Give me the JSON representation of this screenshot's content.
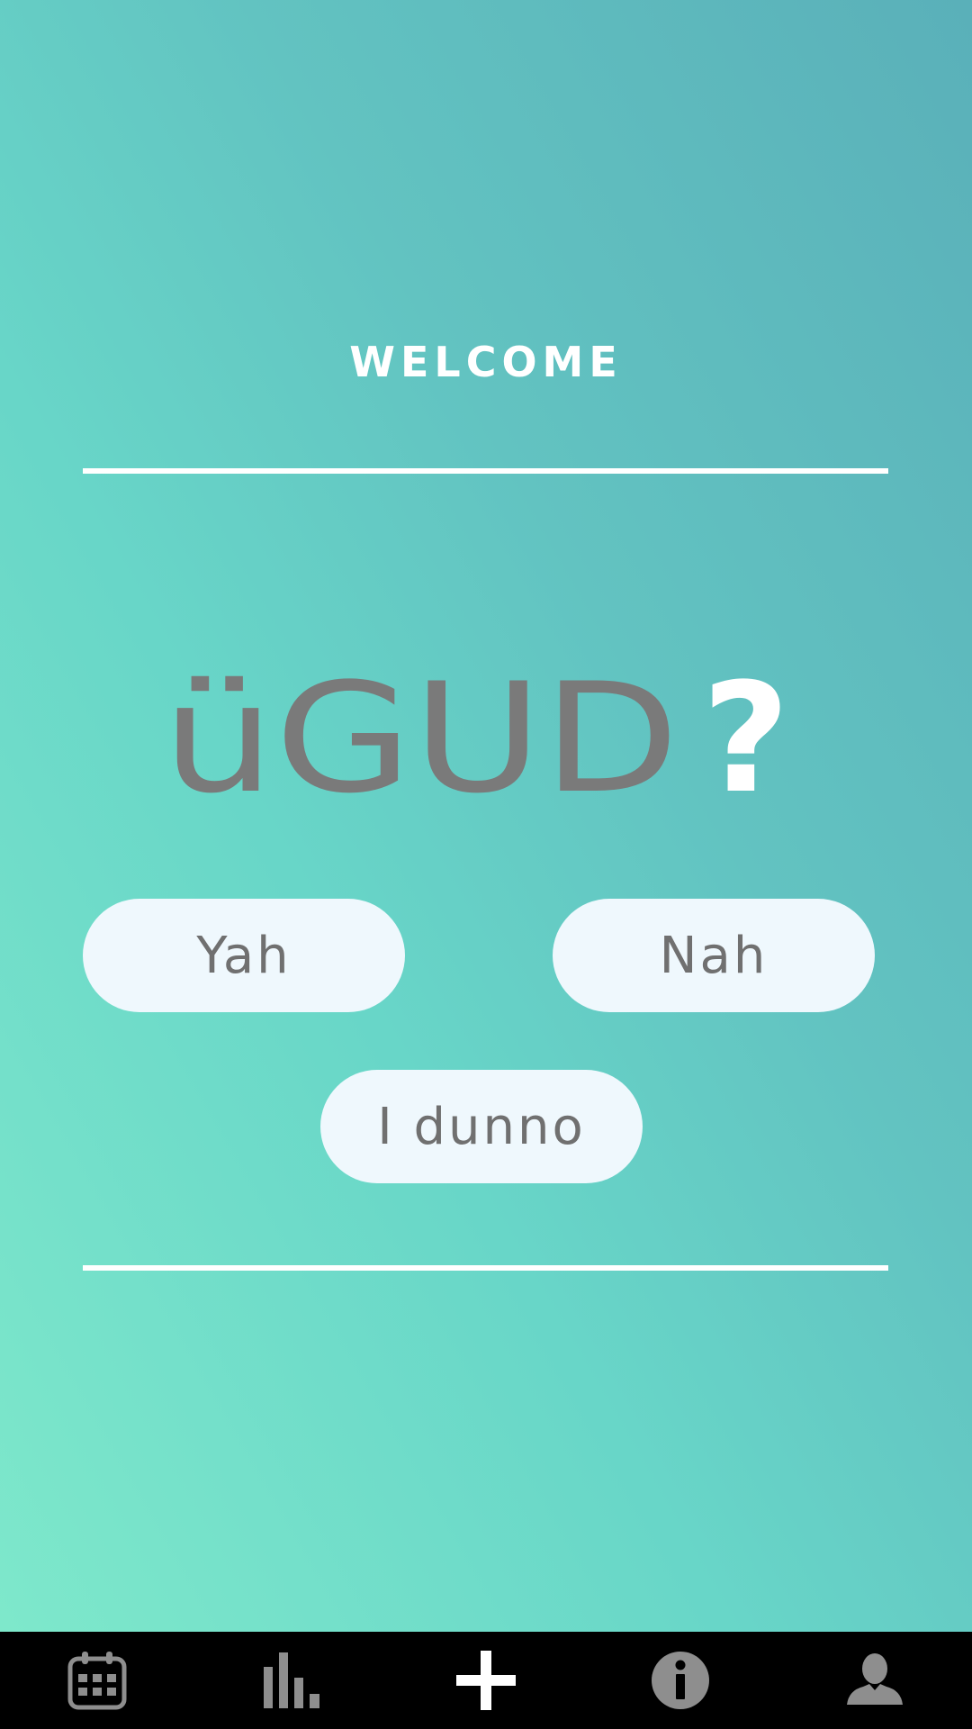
{
  "header": {
    "title": "WELCOME"
  },
  "logo": {
    "text": "üGUD",
    "mark": "?",
    "text_color": "#7a7a7a",
    "mark_color": "#ffffff"
  },
  "answers": {
    "yes_label": "Yah",
    "no_label": "Nah",
    "unsure_label": "I dunno"
  },
  "nav": {
    "items": [
      {
        "icon": "calendar-icon",
        "active": false
      },
      {
        "icon": "bar-chart-icon",
        "active": false
      },
      {
        "icon": "plus-icon",
        "active": true
      },
      {
        "icon": "info-icon",
        "active": false
      },
      {
        "icon": "user-icon",
        "active": false
      }
    ]
  },
  "colors": {
    "background_gradient": [
      "#7ee8cb",
      "#5ab0b9"
    ],
    "button_bg": "#eff8fd",
    "button_text": "#707070",
    "navbar_bg": "#000000",
    "nav_icon_inactive": "#8e8e8e",
    "nav_icon_active": "#ffffff"
  }
}
